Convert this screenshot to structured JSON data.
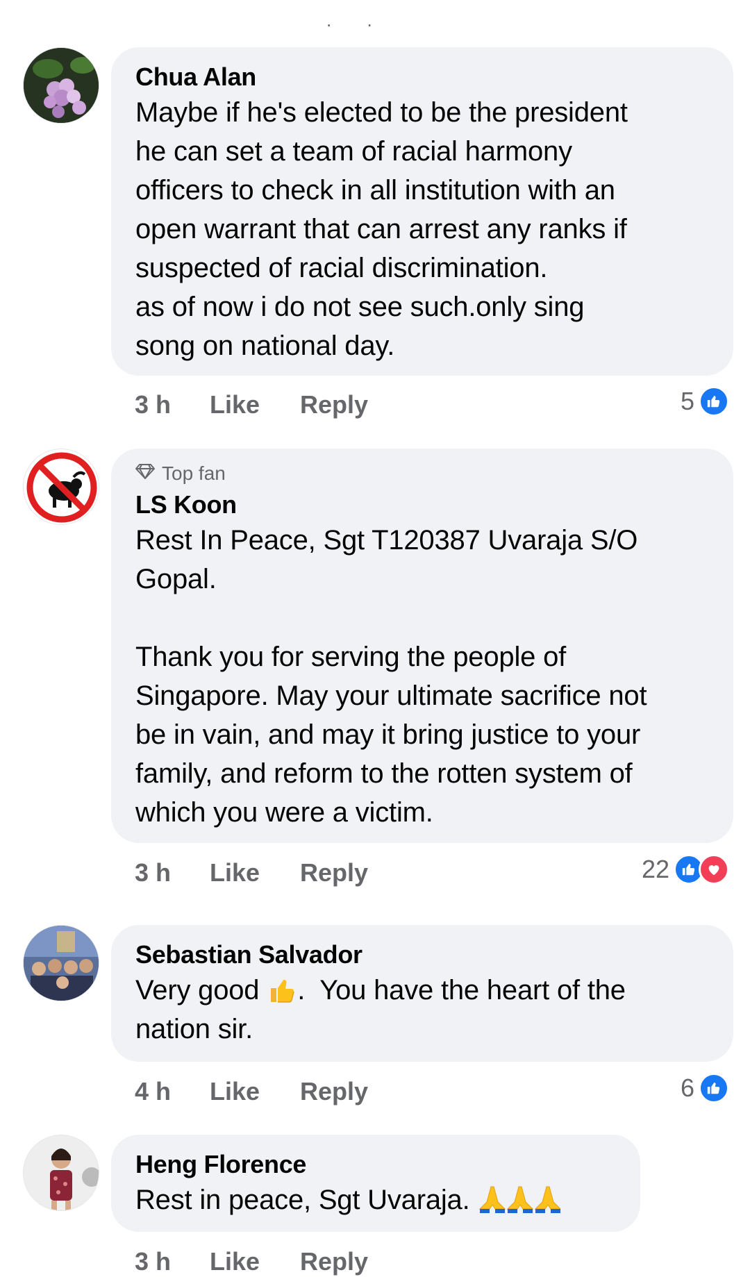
{
  "top": {
    "dots": ". ."
  },
  "comments": [
    {
      "author": "Chua Alan",
      "badge": "",
      "text": "Maybe if he's elected to be the president\nhe can set a team of racial harmony\nofficers to check in all institution with an\nopen warrant that can arrest any ranks if\nsuspected of racial discrimination.\nas of now i do not see such.only sing\nsong on national day.",
      "time": "3 h",
      "like": "Like",
      "reply": "Reply",
      "reaction_count": "5"
    },
    {
      "author": "LS Koon",
      "badge": "Top fan",
      "text": "Rest In Peace, Sgt T120387 Uvaraja S/O\nGopal.\n\nThank you for serving the people of\nSingapore. May your ultimate sacrifice not\nbe in vain, and may it bring justice to your\nfamily, and reform to the rotten system of\nwhich you were a victim.",
      "time": "3 h",
      "like": "Like",
      "reply": "Reply",
      "reaction_count": "22"
    },
    {
      "author": "Sebastian Salvador",
      "badge": "",
      "text_before": "Very good ",
      "text_after": ".  You have the heart of the\nnation sir.",
      "time": "4 h",
      "like": "Like",
      "reply": "Reply",
      "reaction_count": "6"
    },
    {
      "author": "Heng Florence",
      "badge": "",
      "text": "Rest in peace, Sgt Uvaraja. ",
      "time": "3 h",
      "like": "Like",
      "reply": "Reply"
    }
  ],
  "colors": {
    "like_blue": "#1877f2",
    "love_red": "#f33e58",
    "bubble": "#f0f2f5",
    "meta_gray": "#65676b"
  }
}
